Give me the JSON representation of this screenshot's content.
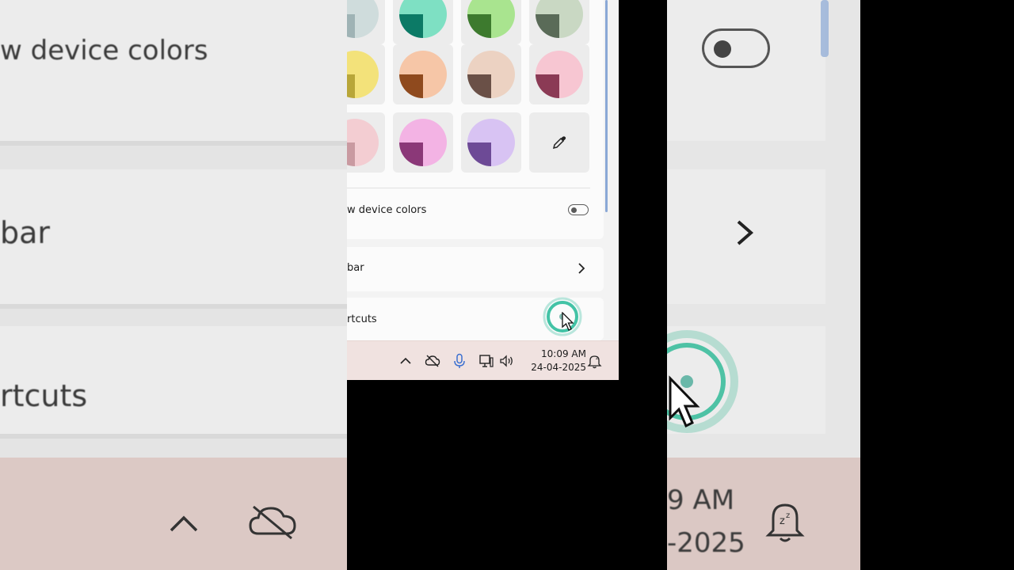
{
  "background_left": {
    "row1_text": "w device colors",
    "row2_text": "bar",
    "row3_text": "rtcuts"
  },
  "background_right": {
    "time_text": "9 AM",
    "date_text": "-2025"
  },
  "personalization": {
    "swatches": [
      {
        "name": "slate",
        "light": "#cfdcdc",
        "dark": "#9fb3b5"
      },
      {
        "name": "teal",
        "light": "#7ee0c3",
        "dark": "#0c7a66"
      },
      {
        "name": "green",
        "light": "#a9e48f",
        "dark": "#3d7a2e"
      },
      {
        "name": "sage",
        "light": "#c9d8c3",
        "dark": "#5a6b58"
      },
      {
        "name": "yellow",
        "light": "#f3e27a",
        "dark": "#b8a639"
      },
      {
        "name": "peach",
        "light": "#f6c6a7",
        "dark": "#8f4a1e"
      },
      {
        "name": "sand",
        "light": "#ecd2c2",
        "dark": "#6a5047"
      },
      {
        "name": "rose",
        "light": "#f7c6d2",
        "dark": "#8b3a55"
      },
      {
        "name": "blush",
        "light": "#f3cdd2",
        "dark": "#c99aa1"
      },
      {
        "name": "pink",
        "light": "#f3b3e4",
        "dark": "#8b3878"
      },
      {
        "name": "lavender",
        "light": "#d8c3f3",
        "dark": "#6d4a96"
      }
    ],
    "show_device_colors_label": "w device colors",
    "show_device_colors_on": false,
    "taskbar_row_label": "bar",
    "shortcuts_row_label": "rtcuts"
  },
  "taskbar": {
    "time": "10:09 AM",
    "date": "24-04-2025"
  }
}
